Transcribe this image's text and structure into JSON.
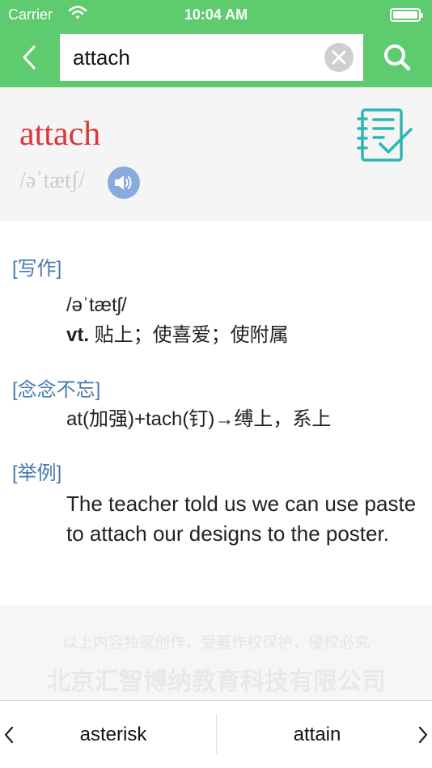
{
  "status_bar": {
    "carrier": "Carrier",
    "time": "10:04 AM"
  },
  "search": {
    "value": "attach",
    "placeholder": ""
  },
  "entry": {
    "word": "attach",
    "phonetic": "/əˈtætʃ/"
  },
  "sections": {
    "writing": {
      "title": "[写作]",
      "phonetic": "/əˈtætʃ/",
      "pos": "vt.",
      "meaning": " 贴上；使喜爱；使附属"
    },
    "memory": {
      "title": "[念念不忘]",
      "text": "at(加强)+tach(钉)→缚上，系上"
    },
    "example": {
      "title": "[举例]",
      "text": "The teacher told us we can use paste to attach our designs to the poster."
    }
  },
  "copyright": {
    "line1": "以上内容独家创作，受著作权保护，侵权必究",
    "line2": "北京汇智博纳教育科技有限公司"
  },
  "navigation": {
    "prev_word": "asterisk",
    "next_word": "attain"
  },
  "colors": {
    "nav_green": "#5ecb6f",
    "headword_red": "#d9383a",
    "section_blue": "#4a78b0",
    "notebook_teal": "#2bb7b4",
    "speaker_blue": "#8aa9de"
  },
  "icons": {
    "back": "chevron-left-icon",
    "clear": "clear-icon",
    "search": "search-icon",
    "speaker": "speaker-icon",
    "notebook": "notebook-check-icon",
    "prev": "chevron-left-icon",
    "next": "chevron-right-icon"
  }
}
